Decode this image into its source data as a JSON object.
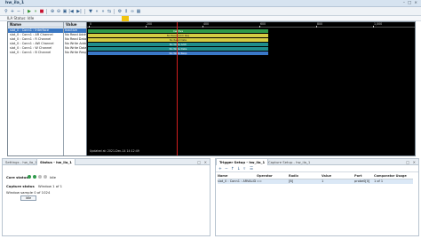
{
  "window": {
    "title": "hw_ila_1"
  },
  "status_text": "ILA Status: Idle",
  "wave": {
    "columns": {
      "name": "Name",
      "value": "Value"
    },
    "signals": [
      {
        "name": "slot_0 : Conn1 : Interface",
        "value": "Inactive",
        "selected": true
      },
      {
        "name": "slot_0 : Conn1 : AR Channel",
        "value": "No Read Addr"
      },
      {
        "name": "slot_0 : Conn1 : R Channel",
        "value": "No Read Data"
      },
      {
        "name": "slot_0 : Conn1 : AW Channel",
        "value": "No Write Addr"
      },
      {
        "name": "slot_0 : Conn1 : W Channel",
        "value": "No Write Data"
      },
      {
        "name": "slot_0 : Conn1 : B Channel",
        "value": "No Write Resp"
      }
    ],
    "bars": [
      {
        "label": "Inactive",
        "color": "#2f9a4b"
      },
      {
        "label": "No Read Addr Req",
        "color": "#d4cd43"
      },
      {
        "label": "No Read Data",
        "color": "#d4cd43"
      },
      {
        "label": "No Write Addr",
        "color": "#1f8d8d"
      },
      {
        "label": "No Write Data",
        "color": "#1f8d8d"
      },
      {
        "label": "No Write Resp",
        "color": "#3a78c8"
      }
    ],
    "ticks": [
      "0",
      "200",
      "400",
      "600",
      "800",
      "1,000"
    ],
    "footer": "Updated at:   2021-Dec-14 14:12:49"
  },
  "settings_panel": {
    "tabs": [
      "Settings - hw_ila_1",
      "Status - hw_ila_1"
    ],
    "active_tab": 1,
    "core_status_label": "Core status",
    "core_status_value": "Idle",
    "capture_status_label": "Capture status",
    "capture_window": "Window 1 of 1",
    "window_sample": "Window sample 0 of 1024",
    "idle_button": "Idle"
  },
  "trigger_panel": {
    "tabs": [
      "Trigger Setup - hw_ila_1",
      "Capture Setup - hw_ila_1"
    ],
    "active_tab": 0,
    "headers": [
      "Name",
      "Operator",
      "Radix",
      "Value",
      "Port",
      "Comparator Usage"
    ],
    "row": [
      "slot_0 : Conn1 : ARVALID",
      "==",
      "[B]",
      "1",
      "probe0[0]",
      "1 of 1"
    ]
  },
  "colors": {
    "accent": "#3a77c2",
    "cursor": "#d11f1f",
    "marker": "#f1c40f"
  }
}
